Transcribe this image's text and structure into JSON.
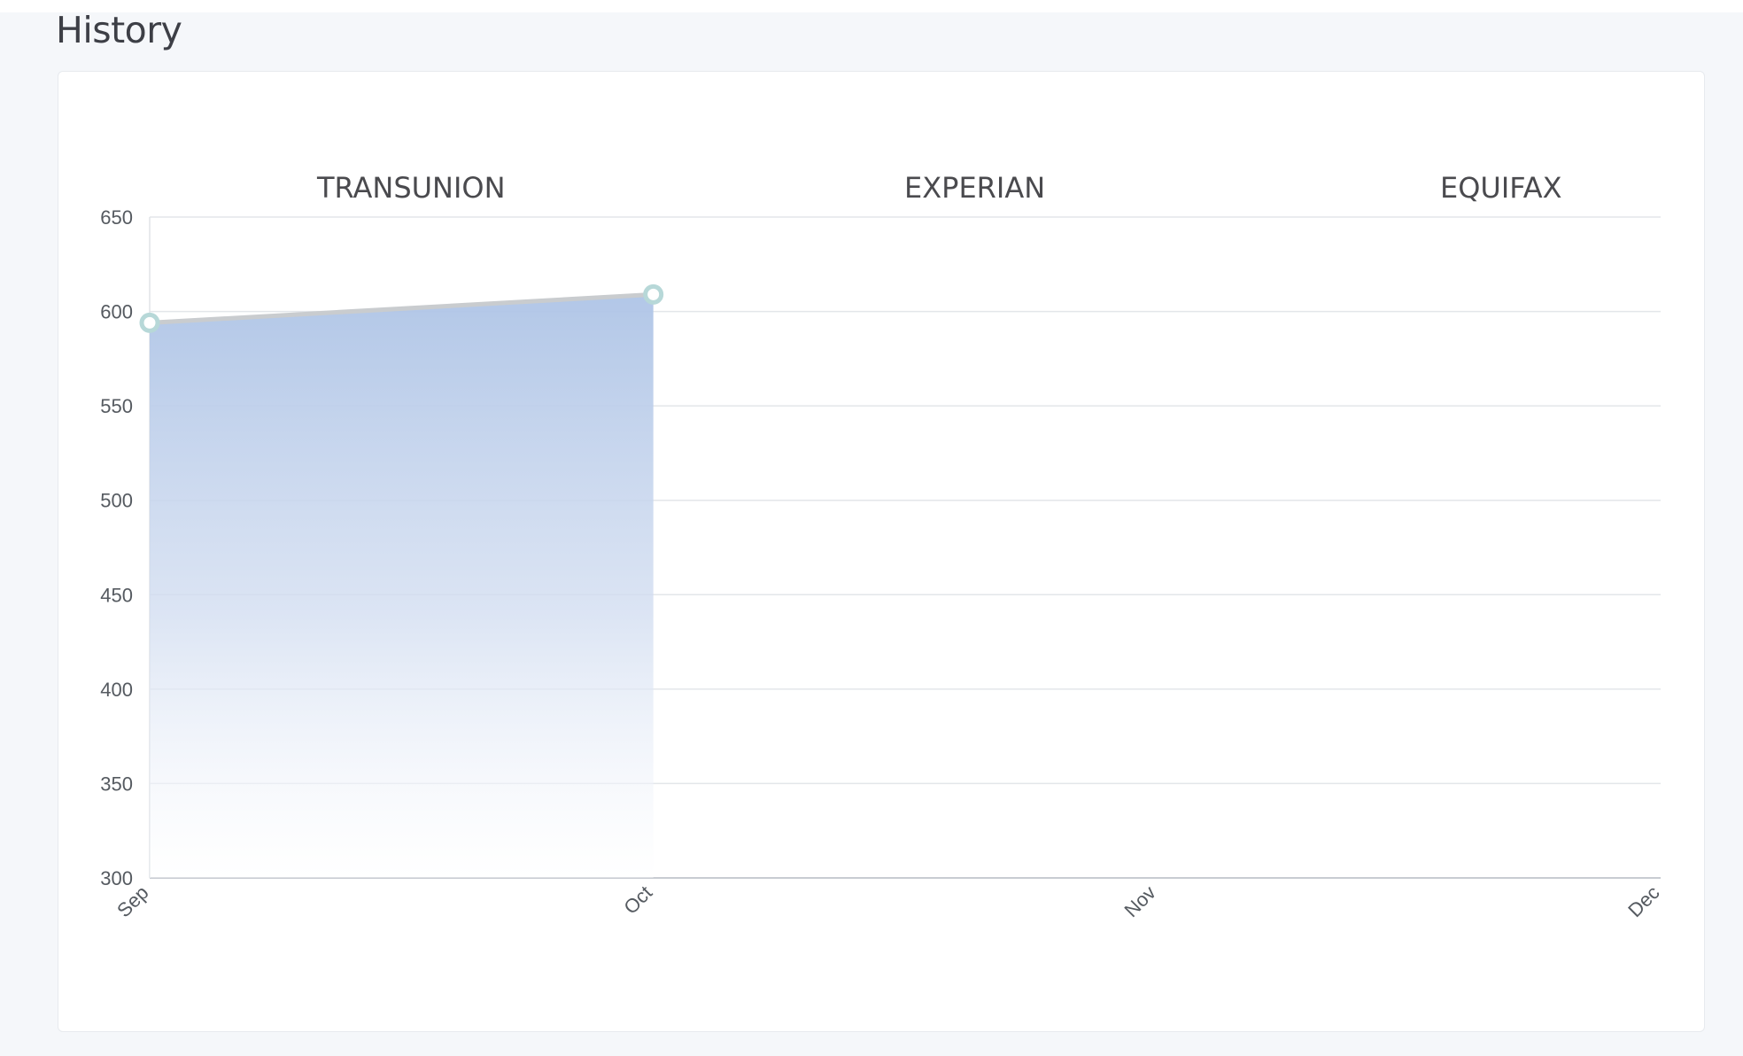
{
  "page": {
    "title": "History"
  },
  "tabs": [
    {
      "label": "TRANSUNION",
      "active": true
    },
    {
      "label": "EXPERIAN",
      "active": false
    },
    {
      "label": "EQUIFAX",
      "active": false
    }
  ],
  "chart_data": {
    "type": "area",
    "x": [
      "Sep",
      "Oct",
      "Nov",
      "Dec"
    ],
    "ylim": [
      300,
      650
    ],
    "yticks": [
      650,
      600,
      550,
      500,
      450,
      400,
      350,
      300
    ],
    "series": [
      {
        "values": [
          594,
          609,
          null,
          null
        ]
      }
    ],
    "grid": true,
    "legend": "none",
    "colors": {
      "fill": "#b3c8e8",
      "line": "#c9cccf",
      "marker": "#b7d8d8"
    }
  }
}
